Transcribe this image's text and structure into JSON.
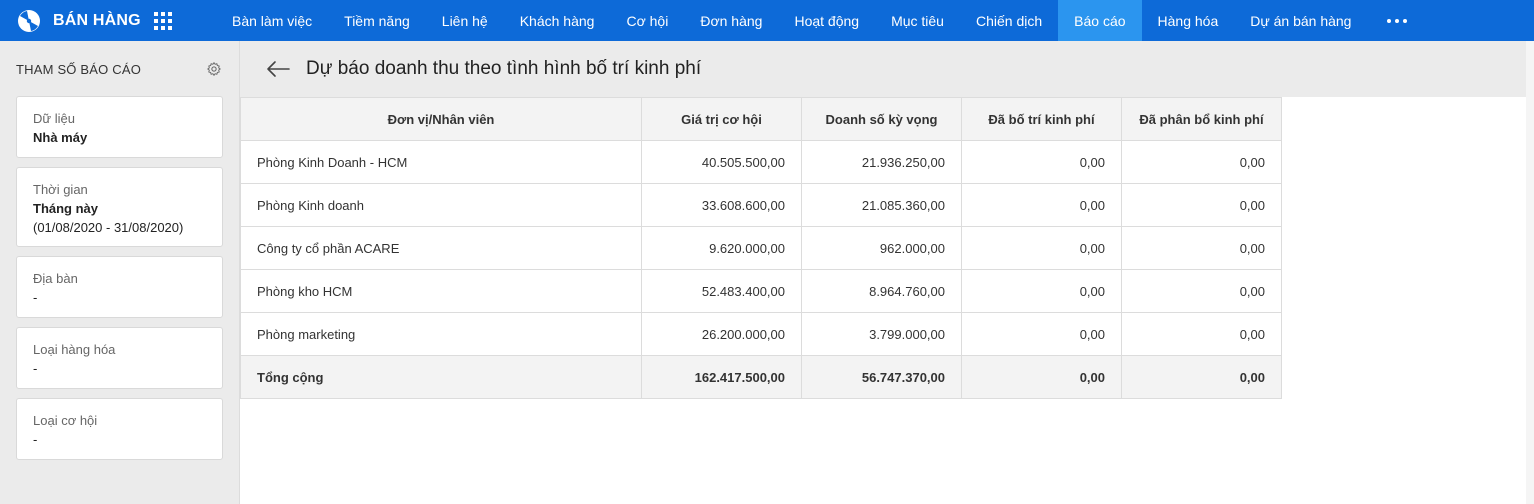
{
  "app": {
    "brand": "BÁN HÀNG"
  },
  "nav": {
    "items": [
      "Bàn làm việc",
      "Tiềm năng",
      "Liên hệ",
      "Khách hàng",
      "Cơ hội",
      "Đơn hàng",
      "Hoạt động",
      "Mục tiêu",
      "Chiến dịch",
      "Báo cáo",
      "Hàng hóa",
      "Dự án bán hàng"
    ],
    "active": "Báo cáo"
  },
  "sidebar": {
    "title": "THAM SỐ BÁO CÁO",
    "filters": [
      {
        "label": "Dữ liệu",
        "value": "Nhà máy"
      },
      {
        "label": "Thời gian",
        "value": "Tháng này",
        "value2": "(01/08/2020 - 31/08/2020)"
      },
      {
        "label": "Địa bàn",
        "value": "-"
      },
      {
        "label": "Loại hàng hóa",
        "value": "-"
      },
      {
        "label": "Loại cơ hội",
        "value": "-"
      }
    ]
  },
  "page": {
    "title": "Dự báo doanh thu theo tình hình bố trí kinh phí"
  },
  "table": {
    "columns": [
      "Đơn vị/Nhân viên",
      "Giá trị cơ hội",
      "Doanh số kỳ vọng",
      "Đã bố trí kinh phí",
      "Đã phân bổ kinh phí"
    ],
    "rows": [
      [
        "Phòng Kinh Doanh - HCM",
        "40.505.500,00",
        "21.936.250,00",
        "0,00",
        "0,00"
      ],
      [
        "Phòng Kinh doanh",
        "33.608.600,00",
        "21.085.360,00",
        "0,00",
        "0,00"
      ],
      [
        "Công ty cổ phần ACARE",
        "9.620.000,00",
        "962.000,00",
        "0,00",
        "0,00"
      ],
      [
        "Phòng kho HCM",
        "52.483.400,00",
        "8.964.760,00",
        "0,00",
        "0,00"
      ],
      [
        "Phòng marketing",
        "26.200.000,00",
        "3.799.000,00",
        "0,00",
        "0,00"
      ]
    ],
    "total": [
      "Tổng cộng",
      "162.417.500,00",
      "56.747.370,00",
      "0,00",
      "0,00"
    ]
  },
  "colors": {
    "nav_bg": "#0d6ad8",
    "nav_active": "#2b95ef",
    "panel_bg": "#ebebeb",
    "header_cell": "#f3f3f3"
  }
}
